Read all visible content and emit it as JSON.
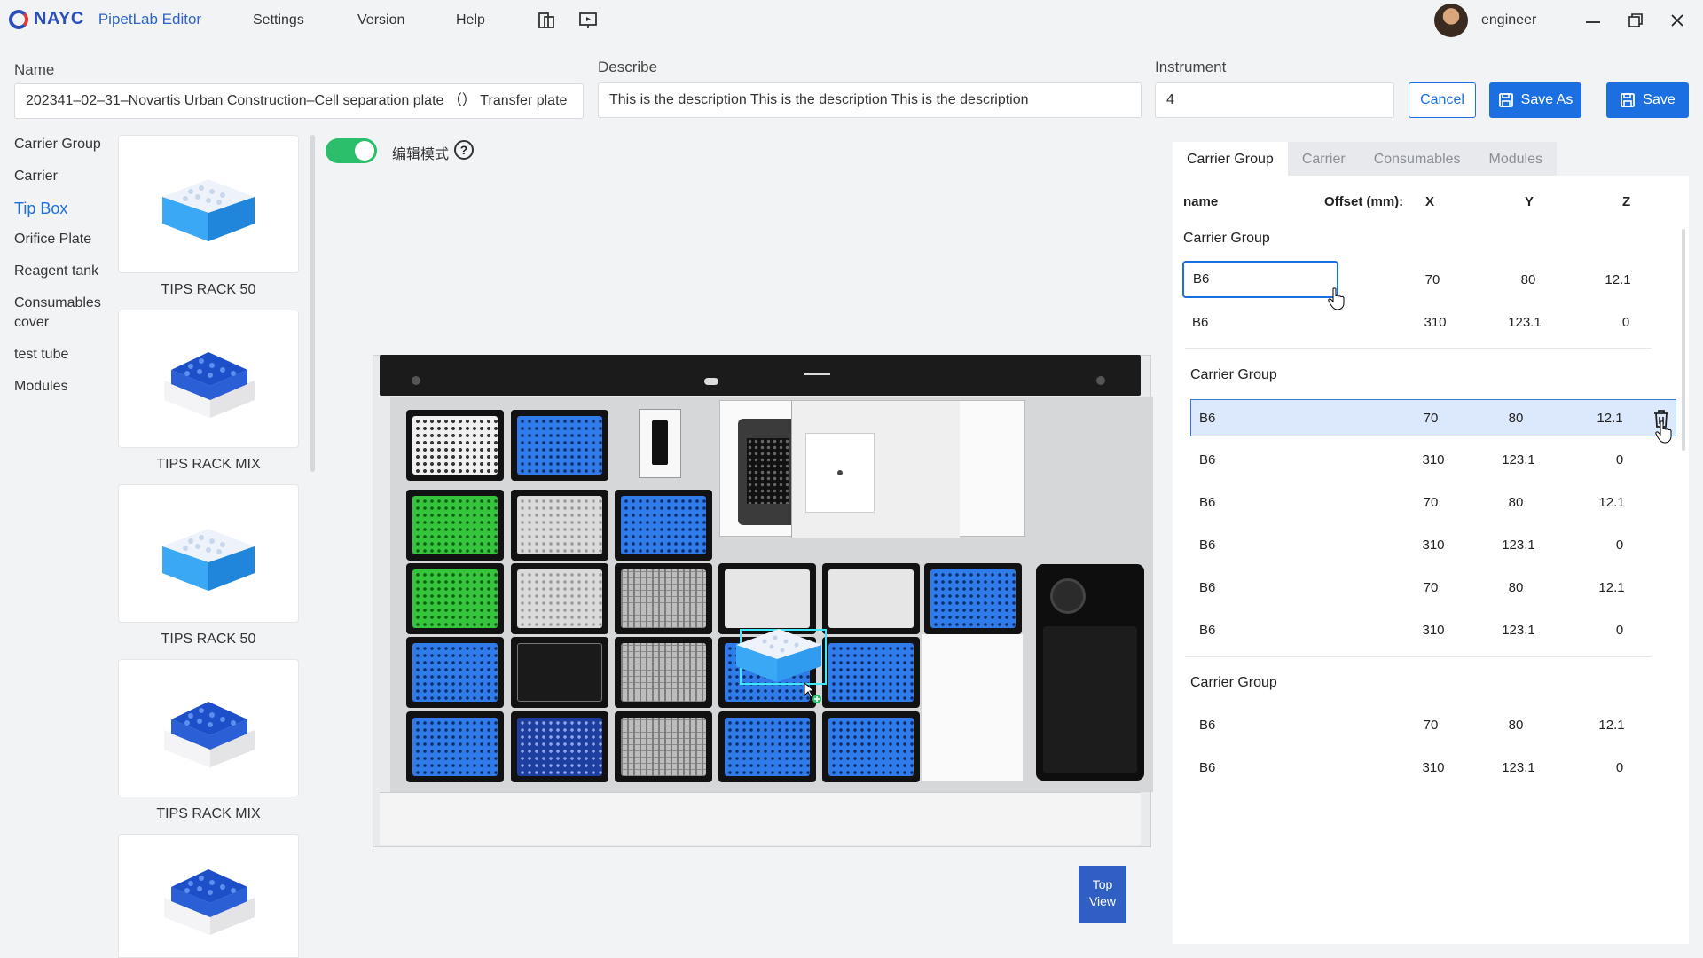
{
  "app": {
    "logo_text": "NAYC",
    "name": "PipetLab Editor"
  },
  "menu": {
    "settings": "Settings",
    "version": "Version",
    "help": "Help"
  },
  "user": {
    "name": "engineer"
  },
  "form": {
    "name_label": "Name",
    "name_value": "202341–02–31–Novartis Urban Construction–Cell separation plate （） Transfer plate",
    "describe_label": "Describe",
    "describe_value": "This is the description This is the description This is the description",
    "instrument_label": "Instrument",
    "instrument_value": "4",
    "cancel_label": "Cancel",
    "save_as_label": "Save As",
    "save_label": "Save"
  },
  "categories": [
    "Carrier Group",
    "Carrier",
    "Tip Box",
    "Orifice Plate",
    "Reagent tank",
    "Consumables cover",
    "test tube",
    "Modules"
  ],
  "active_category": "Tip Box",
  "cards": [
    {
      "label": "TIPS RACK 50",
      "icon": "tips-rack-50-icon"
    },
    {
      "label": "TIPS RACK MIX",
      "icon": "tips-rack-mix-icon"
    },
    {
      "label": "TIPS RACK 50",
      "icon": "tips-rack-50-icon"
    },
    {
      "label": "TIPS RACK MIX",
      "icon": "tips-rack-mix-icon"
    },
    {
      "label": "",
      "icon": "tips-rack-mix-icon"
    }
  ],
  "edit_mode": {
    "label": "编辑模式",
    "on": true
  },
  "top_view": {
    "line1": "Top",
    "line2": "View"
  },
  "right_panel": {
    "tabs": [
      "Carrier Group",
      "Carrier",
      "Consumables",
      "Modules"
    ],
    "active_tab": "Carrier Group",
    "headers": {
      "name": "name",
      "offset": "Offset (mm):",
      "x": "X",
      "y": "Y",
      "z": "Z"
    },
    "groups": [
      {
        "title": "Carrier Group",
        "rows": [
          {
            "name": "B6",
            "x": "70",
            "y": "80",
            "z": "12.1",
            "editing": true
          },
          {
            "name": "B6",
            "x": "310",
            "y": "123.1",
            "z": "0"
          }
        ]
      },
      {
        "title": "Carrier Group",
        "rows": [
          {
            "name": "B6",
            "x": "70",
            "y": "80",
            "z": "12.1",
            "selected": true
          },
          {
            "name": "B6",
            "x": "310",
            "y": "123.1",
            "z": "0"
          },
          {
            "name": "B6",
            "x": "70",
            "y": "80",
            "z": "12.1"
          },
          {
            "name": "B6",
            "x": "310",
            "y": "123.1",
            "z": "0"
          },
          {
            "name": "B6",
            "x": "70",
            "y": "80",
            "z": "12.1"
          },
          {
            "name": "B6",
            "x": "310",
            "y": "123.1",
            "z": "0"
          }
        ]
      },
      {
        "title": "Carrier Group",
        "rows": [
          {
            "name": "B6",
            "x": "70",
            "y": "80",
            "z": "12.1"
          },
          {
            "name": "B6",
            "x": "310",
            "y": "123.1",
            "z": "0"
          }
        ]
      }
    ]
  },
  "colors": {
    "accent": "#1c6fe0",
    "toggle_on": "#2bbf6b",
    "selected_row": "#dce8fb"
  }
}
